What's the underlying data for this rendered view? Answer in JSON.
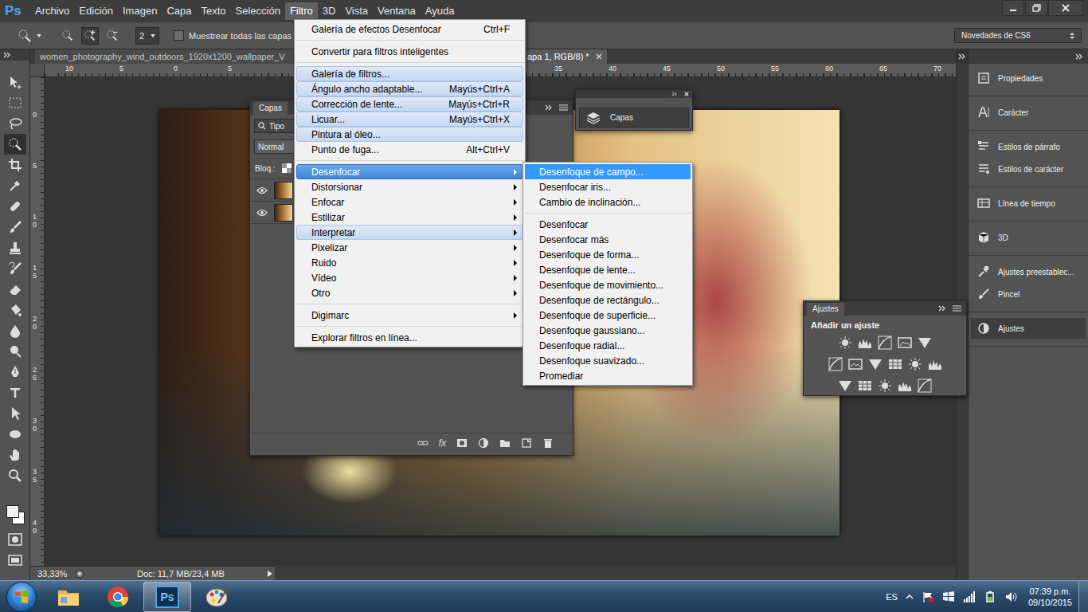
{
  "app": {
    "logo": "Ps"
  },
  "menubar": {
    "items": [
      {
        "label": "Archivo",
        "selected": false
      },
      {
        "label": "Edición",
        "selected": false
      },
      {
        "label": "Imagen",
        "selected": false
      },
      {
        "label": "Capa",
        "selected": false
      },
      {
        "label": "Texto",
        "selected": false
      },
      {
        "label": "Selección",
        "selected": false
      },
      {
        "label": "Filtro",
        "selected": true
      },
      {
        "label": "3D",
        "selected": false
      },
      {
        "label": "Vista",
        "selected": false
      },
      {
        "label": "Ventana",
        "selected": false
      },
      {
        "label": "Ayuda",
        "selected": false
      }
    ]
  },
  "options_bar": {
    "brush_size": "2",
    "sample_all_layers": {
      "label": "Muestrear todas las capas",
      "checked": false
    },
    "auto_enhance": {
      "checked": false
    },
    "workspace": "Novedades de CS6"
  },
  "document_tabs": [
    {
      "label": "women_photography_wind_outdoors_1920x1200_wallpaper_V",
      "selected": false
    },
    {
      "label": "apa 1, RGB/8) *",
      "selected": true
    }
  ],
  "rulers": {
    "top": [
      "10",
      "5",
      "0",
      "5",
      "35",
      "40",
      "45",
      "50",
      "55",
      "60",
      "65",
      "70"
    ],
    "left": [
      "0",
      "5",
      "10",
      "15",
      "20",
      "25",
      "30",
      "35",
      "40"
    ]
  },
  "tools": [
    {
      "selected": false
    },
    {
      "selected": false
    },
    {
      "selected": false
    },
    {
      "selected": true
    },
    {
      "selected": false
    },
    {
      "selected": false
    },
    {
      "selected": false
    },
    {
      "selected": false
    },
    {
      "selected": false
    },
    {
      "selected": false
    },
    {
      "selected": false
    },
    {
      "selected": false
    },
    {
      "selected": false
    },
    {
      "selected": false
    },
    {
      "selected": false
    },
    {
      "selected": false
    },
    {
      "selected": false
    },
    {
      "selected": false
    },
    {
      "selected": false
    },
    {
      "selected": false
    }
  ],
  "filter_menu": {
    "items": [
      {
        "kind": "item",
        "label": "Galería de efectos Desenfocar",
        "shortcut": "Ctrl+F",
        "highlighted": false,
        "selected": false,
        "submenu": false
      },
      {
        "kind": "separator"
      },
      {
        "kind": "item",
        "label": "Convertir para filtros inteligentes",
        "highlighted": false,
        "selected": false,
        "submenu": false
      },
      {
        "kind": "separator"
      },
      {
        "kind": "item",
        "label": "Galería de filtros...",
        "highlighted": true,
        "selected": false,
        "submenu": false
      },
      {
        "kind": "item",
        "label": "Ángulo ancho adaptable...",
        "shortcut": "Mayús+Ctrl+A",
        "highlighted": true,
        "selected": false,
        "submenu": false
      },
      {
        "kind": "item",
        "label": "Corrección de lente...",
        "shortcut": "Mayús+Ctrl+R",
        "highlighted": true,
        "selected": false,
        "submenu": false
      },
      {
        "kind": "item",
        "label": "Licuar...",
        "shortcut": "Mayús+Ctrl+X",
        "highlighted": true,
        "selected": false,
        "submenu": false
      },
      {
        "kind": "item",
        "label": "Pintura al óleo...",
        "highlighted": true,
        "selected": false,
        "submenu": false
      },
      {
        "kind": "item",
        "label": "Punto de fuga...",
        "shortcut": "Alt+Ctrl+V",
        "highlighted": false,
        "selected": false,
        "submenu": false
      },
      {
        "kind": "separator"
      },
      {
        "kind": "item",
        "label": "Desenfocar",
        "highlighted": false,
        "selected": true,
        "submenu": true
      },
      {
        "kind": "item",
        "label": "Distorsionar",
        "highlighted": false,
        "selected": false,
        "submenu": true
      },
      {
        "kind": "item",
        "label": "Enfocar",
        "highlighted": false,
        "selected": false,
        "submenu": true
      },
      {
        "kind": "item",
        "label": "Estilizar",
        "highlighted": false,
        "selected": false,
        "submenu": true
      },
      {
        "kind": "item",
        "label": "Interpretar",
        "highlighted": true,
        "selected": false,
        "submenu": true
      },
      {
        "kind": "item",
        "label": "Pixelizar",
        "highlighted": false,
        "selected": false,
        "submenu": true
      },
      {
        "kind": "item",
        "label": "Ruido",
        "highlighted": false,
        "selected": false,
        "submenu": true
      },
      {
        "kind": "item",
        "label": "Vídeo",
        "highlighted": false,
        "selected": false,
        "submenu": true
      },
      {
        "kind": "item",
        "label": "Otro",
        "highlighted": false,
        "selected": false,
        "submenu": true
      },
      {
        "kind": "separator"
      },
      {
        "kind": "item",
        "label": "Digimarc",
        "highlighted": false,
        "selected": false,
        "submenu": true
      },
      {
        "kind": "separator"
      },
      {
        "kind": "item",
        "label": "Explorar filtros en línea...",
        "highlighted": false,
        "selected": false,
        "submenu": false
      }
    ]
  },
  "blur_submenu": {
    "items": [
      {
        "kind": "item",
        "label": "Desenfoque de campo...",
        "selected": true
      },
      {
        "kind": "item",
        "label": "Desenfocar iris...",
        "selected": false
      },
      {
        "kind": "item",
        "label": "Cambio de inclinación...",
        "selected": false
      },
      {
        "kind": "separator"
      },
      {
        "kind": "item",
        "label": "Desenfocar",
        "selected": false
      },
      {
        "kind": "item",
        "label": "Desenfocar más",
        "selected": false
      },
      {
        "kind": "item",
        "label": "Desenfoque de forma...",
        "selected": false
      },
      {
        "kind": "item",
        "label": "Desenfoque de lente...",
        "selected": false
      },
      {
        "kind": "item",
        "label": "Desenfoque de movimiento...",
        "selected": false
      },
      {
        "kind": "item",
        "label": "Desenfoque de rectángulo...",
        "selected": false
      },
      {
        "kind": "item",
        "label": "Desenfoque de superficie...",
        "selected": false
      },
      {
        "kind": "item",
        "label": "Desenfoque gaussiano...",
        "selected": false
      },
      {
        "kind": "item",
        "label": "Desenfoque radial...",
        "selected": false
      },
      {
        "kind": "item",
        "label": "Desenfoque suavizado...",
        "selected": false
      },
      {
        "kind": "item",
        "label": "Promediar",
        "selected": false
      }
    ]
  },
  "layers_panel": {
    "tab": "Capas",
    "filter": "Tipo",
    "blend_mode": "Normal",
    "lock_label": "Bloq.:",
    "layers": [
      {
        "visible": true,
        "selected": false
      },
      {
        "visible": true,
        "selected": false
      }
    ],
    "footer_fx": "fx"
  },
  "floating_layers_button": {
    "label": "Capas"
  },
  "adjustments_panel": {
    "tab": "Ajustes",
    "subtitle": "Añadir un ajuste"
  },
  "right_dock": {
    "groups": [
      {
        "items": [
          {
            "label": "Propiedades",
            "selected": false
          }
        ]
      },
      {
        "items": [
          {
            "label": "Carácter",
            "selected": false
          }
        ]
      },
      {
        "items": [
          {
            "label": "Estilos de párrafo",
            "selected": false
          },
          {
            "label": "Estilos de carácter",
            "selected": false
          }
        ]
      },
      {
        "items": [
          {
            "label": "Línea de tiempo",
            "selected": false
          }
        ]
      },
      {
        "items": [
          {
            "label": "3D",
            "selected": false
          }
        ]
      },
      {
        "items": [
          {
            "label": "Ajustes preestablec...",
            "selected": false
          },
          {
            "label": "Pincel",
            "selected": false
          }
        ]
      },
      {
        "items": [
          {
            "label": "Ajustes",
            "selected": true
          }
        ]
      }
    ]
  },
  "status_bar": {
    "zoom": "33,33%",
    "doc": "Doc: 11,7 MB/23,4 MB"
  },
  "taskbar": {
    "apps": [
      {
        "selected": false
      },
      {
        "selected": false
      },
      {
        "selected": true,
        "label": "Ps"
      },
      {
        "selected": false
      }
    ],
    "language": "ES",
    "time": "07:39 p.m.",
    "date": "09/10/2015"
  }
}
